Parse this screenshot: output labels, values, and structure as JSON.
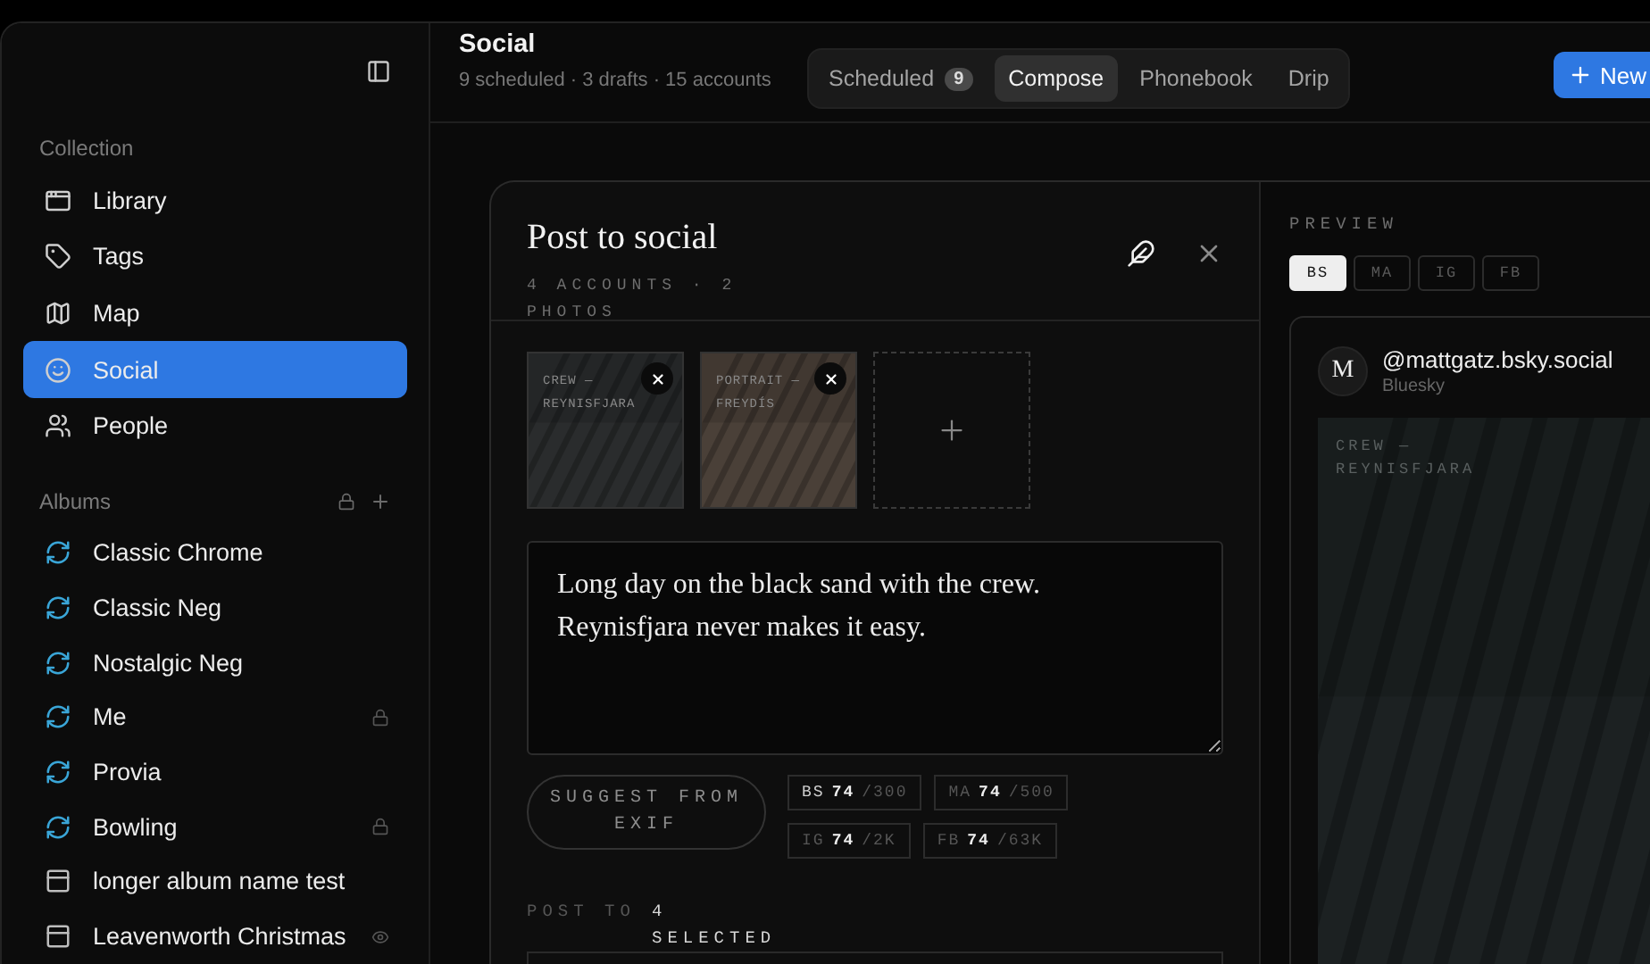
{
  "sidebar": {
    "collection": {
      "title": "Collection",
      "items": [
        {
          "label": "Library",
          "selected": false
        },
        {
          "label": "Tags",
          "selected": false
        },
        {
          "label": "Map",
          "selected": false
        },
        {
          "label": "Social",
          "selected": true
        },
        {
          "label": "People",
          "selected": false
        }
      ]
    },
    "albums": {
      "title": "Albums",
      "items": [
        {
          "kind": "sync",
          "label": "Classic Chrome",
          "locked": false,
          "hidden": false
        },
        {
          "kind": "sync",
          "label": "Classic Neg",
          "locked": false,
          "hidden": false
        },
        {
          "kind": "sync",
          "label": "Nostalgic Neg",
          "locked": false,
          "hidden": false
        },
        {
          "kind": "sync",
          "label": "Me",
          "locked": true,
          "hidden": false
        },
        {
          "kind": "sync",
          "label": "Provia",
          "locked": false,
          "hidden": false
        },
        {
          "kind": "sync",
          "label": "Bowling",
          "locked": true,
          "hidden": false
        },
        {
          "kind": "album",
          "label": "longer album name test",
          "locked": false,
          "hidden": false
        },
        {
          "kind": "album",
          "label": "Leavenworth Christmas",
          "locked": false,
          "hidden": true
        }
      ]
    }
  },
  "header": {
    "title": "Social",
    "subtitle": "9 scheduled · 3 drafts · 15 accounts",
    "tabs": [
      {
        "label": "Scheduled",
        "count": "9",
        "selected": false
      },
      {
        "label": "Compose",
        "selected": true
      },
      {
        "label": "Phonebook",
        "selected": false
      },
      {
        "label": "Drip",
        "selected": false
      }
    ],
    "new_button": "New"
  },
  "composer": {
    "title": "Post to social",
    "subtitle": "4 ACCOUNTS · 2 PHOTOS",
    "photos": [
      {
        "caption": "CREW — REYNISFJARA"
      },
      {
        "caption": "PORTRAIT — FREYDÍS"
      }
    ],
    "caption": "Long day on the black sand with the crew.\nReynisfjara never makes it easy.",
    "suggest_button": "SUGGEST FROM EXIF",
    "counters": [
      {
        "network": "BS",
        "count": "74",
        "limit": "/300",
        "selected": true
      },
      {
        "network": "MA",
        "count": "74",
        "limit": "/500",
        "selected": false
      },
      {
        "network": "IG",
        "count": "74",
        "limit": "/2K",
        "selected": false
      },
      {
        "network": "FB",
        "count": "74",
        "limit": "/63K",
        "selected": false
      }
    ],
    "post_to": {
      "label": "POST TO",
      "value": "4 SELECTED"
    }
  },
  "preview": {
    "title": "PREVIEW",
    "tabs": [
      {
        "label": "BS",
        "selected": true
      },
      {
        "label": "MA",
        "selected": false
      },
      {
        "label": "IG",
        "selected": false
      },
      {
        "label": "FB",
        "selected": false
      }
    ],
    "avatar": "M",
    "handle": "@mattgatz.bsky.social",
    "network": "Bluesky",
    "photo_caption": "CREW — REYNISFJARA"
  }
}
